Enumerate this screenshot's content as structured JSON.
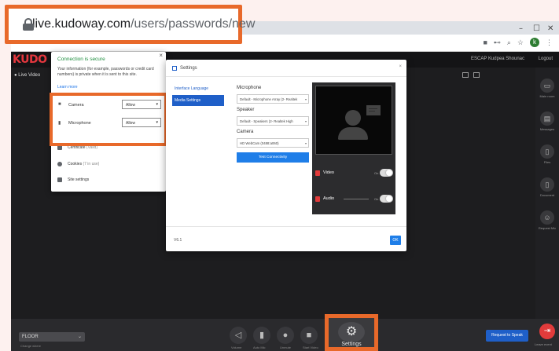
{
  "browser": {
    "url_host": "live.kudoway.com",
    "url_path": "/users/passwords/new",
    "window_controls": [
      "–",
      "☐",
      "✕"
    ],
    "profile_initial": "k",
    "omnibox_icons": [
      "camera-icon",
      "key-icon",
      "zoom-icon",
      "star-icon",
      "profile-avatar",
      "menu-icon"
    ]
  },
  "app": {
    "logo_main": "KUDO",
    "user_text": "ESCAP Kudpea Shounac",
    "logout_label": "Logout",
    "live_video_label": "● Live Video",
    "right_panel": [
      {
        "icon": "chat-icon",
        "label": "Main room"
      },
      {
        "icon": "message-icon",
        "label": "Messages"
      },
      {
        "icon": "files-icon",
        "label": "Files"
      },
      {
        "icon": "document-icon",
        "label": "Document"
      },
      {
        "icon": "user-add-icon",
        "label": "Request Mic"
      }
    ],
    "bottom": {
      "floor_label": "FLOOR",
      "change_note": "Change where",
      "controls": [
        {
          "icon": "volume-icon",
          "label": "Volume"
        },
        {
          "icon": "signal-icon",
          "label": "Auto Mic"
        },
        {
          "icon": "mic-icon",
          "label": "Unmute"
        },
        {
          "icon": "camera-icon",
          "label": "Start Video"
        }
      ],
      "settings_label": "Settings",
      "request_label": "Request to Speak",
      "leave_label": "Leave event"
    }
  },
  "site_info": {
    "title": "Connection is secure",
    "description": "Your information (for example, passwords or credit card numbers) is private when it is sent to this site.",
    "learn_more": "Learn more",
    "permissions": [
      {
        "icon": "camera-icon",
        "label": "Camera",
        "value": "Allow"
      },
      {
        "icon": "microphone-icon",
        "label": "Microphone",
        "value": "Allow"
      }
    ],
    "certificate": "Certificate",
    "certificate_state": "(Valid)",
    "cookies": "Cookies",
    "cookies_state": "(7 in use)",
    "site_settings": "Site settings"
  },
  "settings_modal": {
    "title": "Settings",
    "nav": [
      "Interface Language",
      "Media Settings"
    ],
    "microphone_label": "Microphone",
    "microphone_value": "Default - Microphone Array (2- Realtek",
    "speaker_label": "Speaker",
    "speaker_value": "Default - Speakers (2- Realtek High",
    "camera_label": "Camera",
    "camera_value": "HD WebCam (0488:a060)",
    "test_button": "Test Connectivity",
    "video_label": "Video",
    "audio_label": "Audio",
    "on_label": "On",
    "version": "V6.1",
    "ok_label": "OK"
  },
  "colors": {
    "callout": "#e8692a",
    "brand_red": "#e4373e",
    "primary_blue": "#1f5fc8",
    "secure_green": "#1e8e3e"
  }
}
